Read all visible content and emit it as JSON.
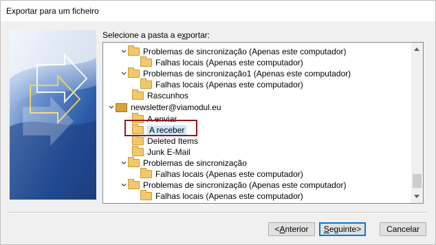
{
  "window": {
    "title": "Exportar para um ficheiro"
  },
  "prompt": {
    "before": "Selecione a pasta a e",
    "accel": "x",
    "after": "portar:"
  },
  "tree": {
    "items": [
      {
        "label": "Problemas de sincronização (Apenas este computador)",
        "icon": "folder-icon",
        "expanded": true
      },
      {
        "label": "Falhas locais (Apenas este computador)",
        "icon": "folder-icon"
      },
      {
        "label": "Problemas de sincronização1 (Apenas este computador)",
        "icon": "folder-icon",
        "expanded": true
      },
      {
        "label": "Falhas locais (Apenas este computador)",
        "icon": "folder-icon"
      },
      {
        "label": "Rascunhos",
        "icon": "folder-icon"
      },
      {
        "label": "newsletter@viamodul.eu",
        "icon": "account-icon",
        "expanded": true
      },
      {
        "label": "A enviar",
        "icon": "folder-icon"
      },
      {
        "label": "A receber",
        "icon": "folder-icon",
        "selected": true
      },
      {
        "label": "Deleted Items",
        "icon": "folder-icon"
      },
      {
        "label": "Junk E-Mail",
        "icon": "folder-icon"
      },
      {
        "label": "Problemas de sincronização",
        "icon": "folder-icon",
        "expanded": true
      },
      {
        "label": "Falhas locais (Apenas este computador)",
        "icon": "folder-icon"
      },
      {
        "label": "Problemas de sincronização (Apenas este computador)",
        "icon": "folder-icon",
        "expanded": true
      },
      {
        "label": "Falhas locais (Apenas este computador)",
        "icon": "folder-icon"
      }
    ]
  },
  "buttons": {
    "back": {
      "prefix": "< ",
      "accel": "A",
      "rest": "nterior"
    },
    "next": {
      "accel": "S",
      "rest": "eguinte",
      "suffix": " >"
    },
    "cancel": "Cancelar"
  }
}
